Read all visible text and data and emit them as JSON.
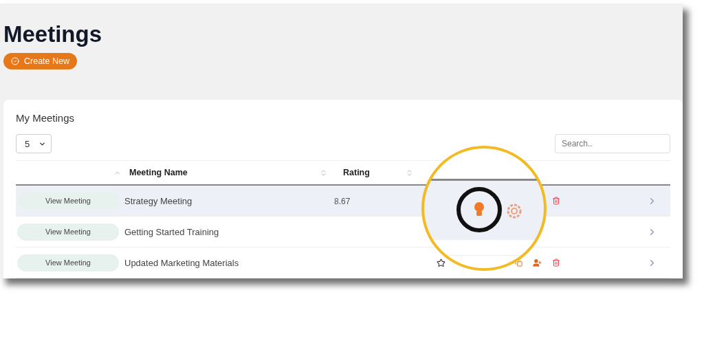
{
  "page": {
    "title": "Meetings",
    "create_button": "Create New"
  },
  "card": {
    "title": "My Meetings",
    "page_size": "5",
    "search": {
      "placeholder": "Search.."
    }
  },
  "columns": [
    {
      "kind": "action",
      "sorted": true
    },
    {
      "kind": "text",
      "label": "Meeting Name",
      "sorted": false
    },
    {
      "kind": "number",
      "label": "Rating",
      "sorted": false
    }
  ],
  "rows": [
    {
      "button": "View Meeting",
      "name": "Strategy Meeting",
      "rating": "8.67",
      "selected": true,
      "actions": [
        {
          "kind": "trash"
        }
      ]
    },
    {
      "button": "View Meeting",
      "name": "Getting Started Training",
      "selected": false
    },
    {
      "button": "View Meeting",
      "name": "Updated Marketing Materials",
      "selected": false,
      "actions": [
        {
          "kind": "star"
        },
        {
          "kind": "copy"
        },
        {
          "kind": "add-user"
        },
        {
          "kind": "trash"
        }
      ]
    }
  ]
}
